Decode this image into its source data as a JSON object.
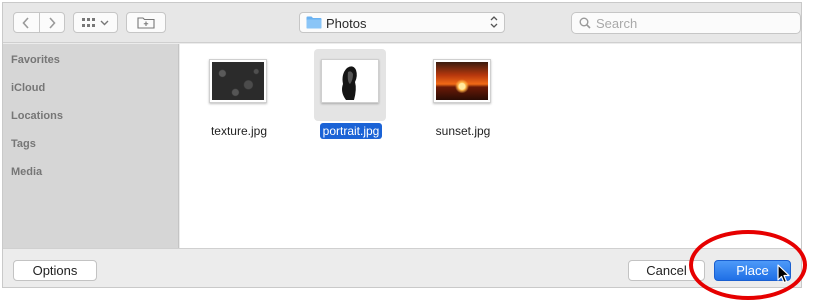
{
  "toolbar": {
    "back_icon": "chevron-left-icon",
    "forward_icon": "chevron-right-icon",
    "view_icon": "icon-grid-view-icon",
    "new_folder_icon": "new-folder-icon",
    "location": "Photos",
    "search_placeholder": "Search"
  },
  "sidebar": {
    "items": [
      {
        "label": "Favorites"
      },
      {
        "label": "iCloud"
      },
      {
        "label": "Locations"
      },
      {
        "label": "Tags"
      },
      {
        "label": "Media"
      }
    ]
  },
  "files": [
    {
      "name": "texture.jpg",
      "selected": false
    },
    {
      "name": "portrait.jpg",
      "selected": true
    },
    {
      "name": "sunset.jpg",
      "selected": false
    }
  ],
  "footer": {
    "options_label": "Options",
    "cancel_label": "Cancel",
    "place_label": "Place"
  },
  "colors": {
    "selection": "#1b63d6",
    "primary_button": "#1f6fe6",
    "annotation": "#e60000"
  }
}
